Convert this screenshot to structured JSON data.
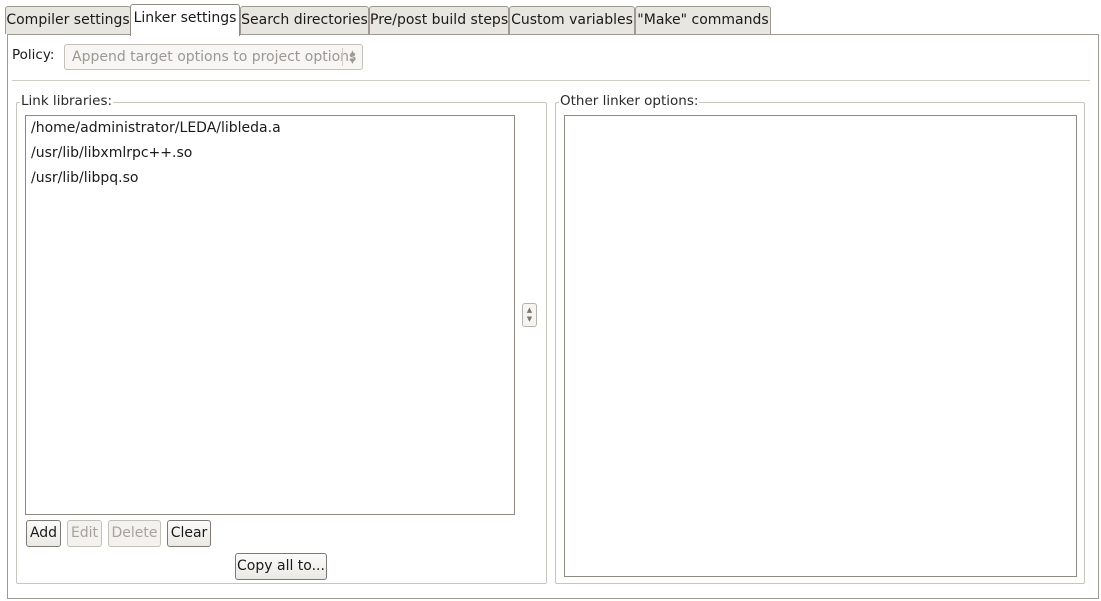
{
  "tabs": [
    {
      "label": "Compiler settings"
    },
    {
      "label": "Linker settings"
    },
    {
      "label": "Search directories"
    },
    {
      "label": "Pre/post build steps"
    },
    {
      "label": "Custom variables"
    },
    {
      "label": "\"Make\" commands"
    }
  ],
  "active_tab": "Linker settings",
  "policy": {
    "label": "Policy:",
    "value": "Append target options to project options",
    "enabled": false
  },
  "link_libraries": {
    "title": "Link libraries:",
    "items": [
      "/home/administrator/LEDA/libleda.a",
      "/usr/lib/libxmlrpc++.so",
      "/usr/lib/libpq.so"
    ],
    "buttons": {
      "add": "Add",
      "edit": "Edit",
      "delete": "Delete",
      "clear": "Clear",
      "copy_all": "Copy all to..."
    }
  },
  "other_linker_options": {
    "title": "Other linker options:",
    "value": ""
  },
  "icons": {
    "combo_arrows": "spin-arrows-icon",
    "splitter_arrows": "splitter-arrows-icon"
  }
}
